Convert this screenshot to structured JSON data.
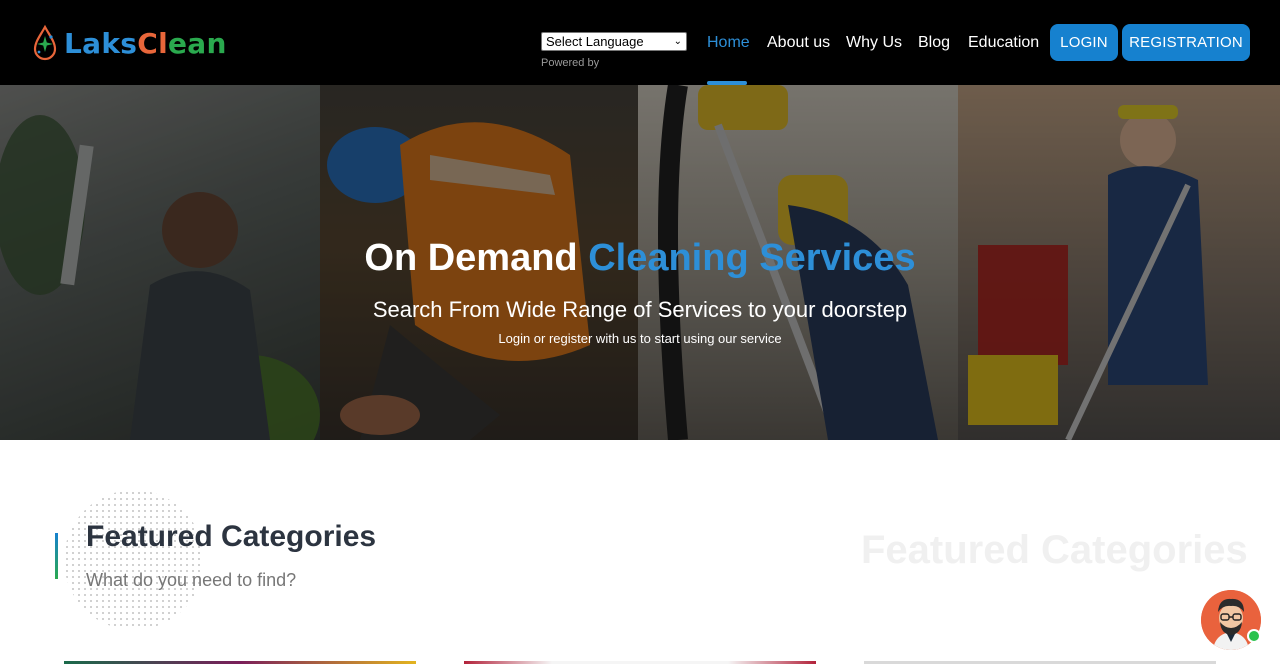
{
  "header": {
    "logo": {
      "part1": "Laks",
      "part2a": "Cl",
      "part2b": "ean"
    },
    "language": {
      "selected": "Select Language",
      "powered_by": "Powered by"
    },
    "nav": [
      {
        "label": "Home",
        "active": true
      },
      {
        "label": "About us",
        "active": false
      },
      {
        "label": "Why Us",
        "active": false
      },
      {
        "label": "Blog",
        "active": false
      },
      {
        "label": "Education",
        "active": false
      }
    ],
    "login_label": "LOGIN",
    "register_label": "REGISTRATION"
  },
  "hero": {
    "title_white": "On Demand ",
    "title_blue": "Cleaning Services",
    "subtitle": "Search From Wide Range of Services to your doorstep",
    "note": "Login or register with us to start using our service"
  },
  "featured": {
    "title": "Featured Categories",
    "subtitle": "What do you need to find?",
    "ghost_title": "Featured Categories"
  },
  "colors": {
    "accent": "#1681cf",
    "brand_blue": "#2d8fd8",
    "brand_orange": "#e8663a",
    "brand_green": "#2aa94e",
    "header_bg": "#000000"
  },
  "icons": {
    "logo": "droplet-sparkle-icon",
    "language_dropdown": "chevron-down-icon",
    "chat": "support-agent-avatar-icon"
  }
}
